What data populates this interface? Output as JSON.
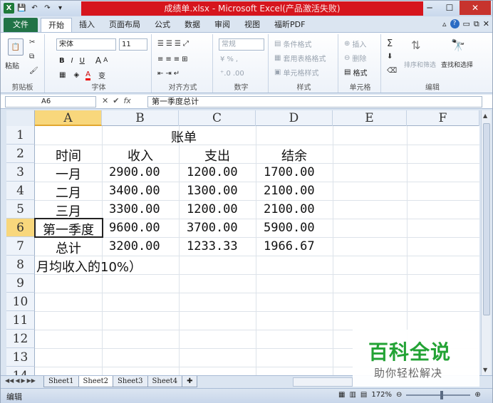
{
  "window": {
    "title": "成绩单.xlsx - Microsoft Excel(产品激活失败)",
    "buttons": {
      "minimize": "─",
      "maximize": "☐",
      "close": "✕"
    }
  },
  "ribbon_tabs": {
    "file": "文件",
    "tabs": [
      "开始",
      "插入",
      "页面布局",
      "公式",
      "数据",
      "审阅",
      "视图",
      "福昕PDF"
    ],
    "active_index": 0
  },
  "ribbon": {
    "clipboard": {
      "label": "剪贴板",
      "paste": "粘贴"
    },
    "font": {
      "label": "字体",
      "font_name": "宋体",
      "font_size": "11",
      "bold": "B",
      "italic": "I",
      "underline": "U",
      "grow": "A",
      "shrink": "A",
      "font_color": "A",
      "phonetic": "变"
    },
    "alignment": {
      "label": "对齐方式"
    },
    "number": {
      "label": "数字",
      "format": "常规",
      "percent": "%",
      "comma": ","
    },
    "styles": {
      "label": "样式",
      "conditional": "条件格式",
      "table": "套用表格格式",
      "cell_styles": "单元格样式"
    },
    "cells": {
      "label": "单元格",
      "insert": "插入",
      "delete": "删除",
      "format": "格式"
    },
    "editing": {
      "label": "编辑",
      "sum": "Σ",
      "sort_filter": "排序和筛选",
      "find_select": "查找和选择"
    }
  },
  "formula_bar": {
    "name_box": "A6",
    "formula": "第一季度总计"
  },
  "columns": [
    "A",
    "B",
    "C",
    "D",
    "E",
    "F"
  ],
  "rows": [
    "1",
    "2",
    "3",
    "4",
    "5",
    "6",
    "7",
    "8",
    "9",
    "10",
    "11",
    "12",
    "13",
    "14"
  ],
  "selected_cell": {
    "col": "A",
    "row": "6"
  },
  "sheet": {
    "title": "账单",
    "headers": [
      "时间",
      "收入",
      "支出",
      "结余"
    ],
    "data": [
      [
        "一月",
        "2900.00",
        "1200.00",
        "1700.00"
      ],
      [
        "二月",
        "3400.00",
        "1300.00",
        "2100.00"
      ],
      [
        "三月",
        "3300.00",
        "1200.00",
        "2100.00"
      ],
      [
        "第一季度",
        "9600.00",
        "3700.00",
        "5900.00"
      ],
      [
        "总计",
        "3200.00",
        "1233.33",
        "1966.67"
      ]
    ],
    "note": "月均收入的10%）"
  },
  "sheet_tabs": [
    "Sheet1",
    "Sheet2",
    "Sheet3",
    "Sheet4"
  ],
  "active_sheet_index": 1,
  "status": {
    "mode": "编辑",
    "zoom": "172%"
  },
  "watermark": {
    "main": "百科全说",
    "sub": "助你轻松解决"
  }
}
